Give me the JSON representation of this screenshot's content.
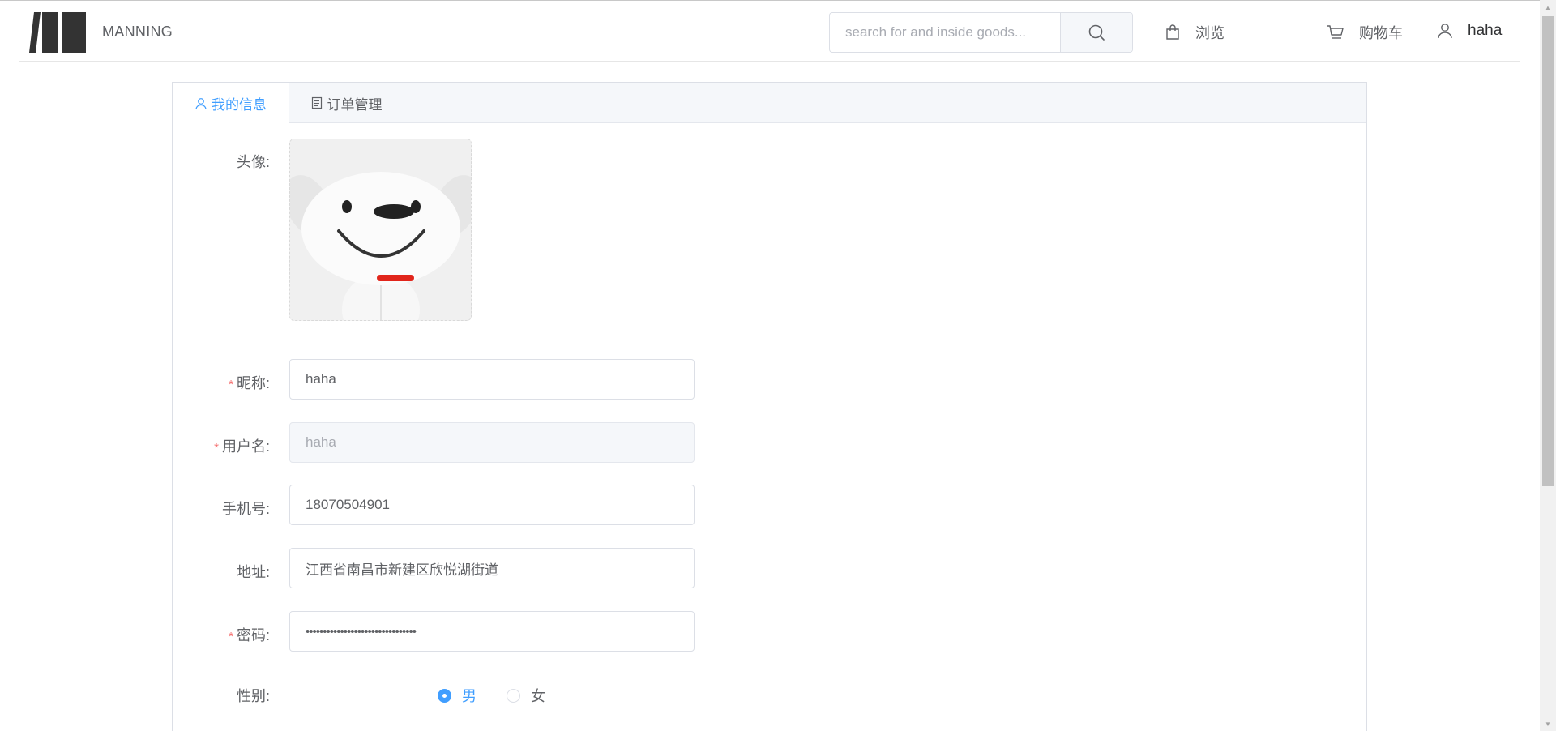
{
  "header": {
    "brand": "MANNING",
    "search": {
      "placeholder": "search for and inside goods...",
      "value": ""
    },
    "nav": {
      "browse": "浏览",
      "cart": "购物车",
      "user": "haha"
    }
  },
  "tabs": [
    {
      "label": "我的信息",
      "active": true
    },
    {
      "label": "订单管理",
      "active": false
    }
  ],
  "form": {
    "avatar_label": "头像:",
    "nickname": {
      "label": "昵称:",
      "required": true,
      "value": "haha"
    },
    "username": {
      "label": "用户名:",
      "required": true,
      "value": "haha",
      "disabled": true
    },
    "phone": {
      "label": "手机号:",
      "required": false,
      "value": "18070504901"
    },
    "address": {
      "label": "地址:",
      "required": false,
      "value": "江西省南昌市新建区欣悦湖街道"
    },
    "password": {
      "label": "密码:",
      "required": true,
      "value": "••••••••••••••••••••••••••••••••"
    },
    "gender": {
      "label": "性别:",
      "options": [
        "男",
        "女"
      ],
      "selected": "男"
    }
  },
  "colors": {
    "accent": "#409eff",
    "required": "#f56c6c",
    "text": "#606266",
    "border": "#dcdfe6"
  }
}
